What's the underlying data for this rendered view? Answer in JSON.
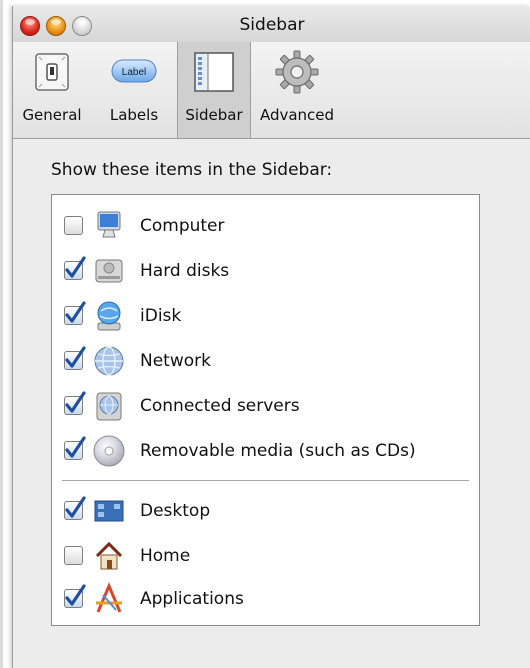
{
  "window": {
    "title": "Sidebar"
  },
  "toolbar": {
    "icon_label_text": "Label",
    "items": [
      {
        "label": "General",
        "icon": "general-switch-icon",
        "selected": false
      },
      {
        "label": "Labels",
        "icon": "label-pill-icon",
        "selected": false
      },
      {
        "label": "Sidebar",
        "icon": "sidebar-window-icon",
        "selected": true
      },
      {
        "label": "Advanced",
        "icon": "gear-icon",
        "selected": false
      }
    ]
  },
  "sidebar_prefs": {
    "heading": "Show these items in the Sidebar:",
    "items": [
      {
        "label": "Computer",
        "checked": false,
        "icon": "computer-icon"
      },
      {
        "label": "Hard disks",
        "checked": true,
        "icon": "hard-disk-icon"
      },
      {
        "label": "iDisk",
        "checked": true,
        "icon": "idisk-icon"
      },
      {
        "label": "Network",
        "checked": true,
        "icon": "network-globe-icon"
      },
      {
        "label": "Connected servers",
        "checked": true,
        "icon": "server-icon"
      },
      {
        "label": "Removable media (such as CDs)",
        "checked": true,
        "icon": "cd-icon"
      },
      {
        "label": "Desktop",
        "checked": true,
        "icon": "desktop-icon"
      },
      {
        "label": "Home",
        "checked": false,
        "icon": "home-icon"
      },
      {
        "label": "Applications",
        "checked": true,
        "icon": "applications-icon"
      }
    ]
  },
  "colors": {
    "check": "#1f4f9e",
    "selected_tab": "#cfcfcf",
    "window_bg": "#ececec"
  }
}
